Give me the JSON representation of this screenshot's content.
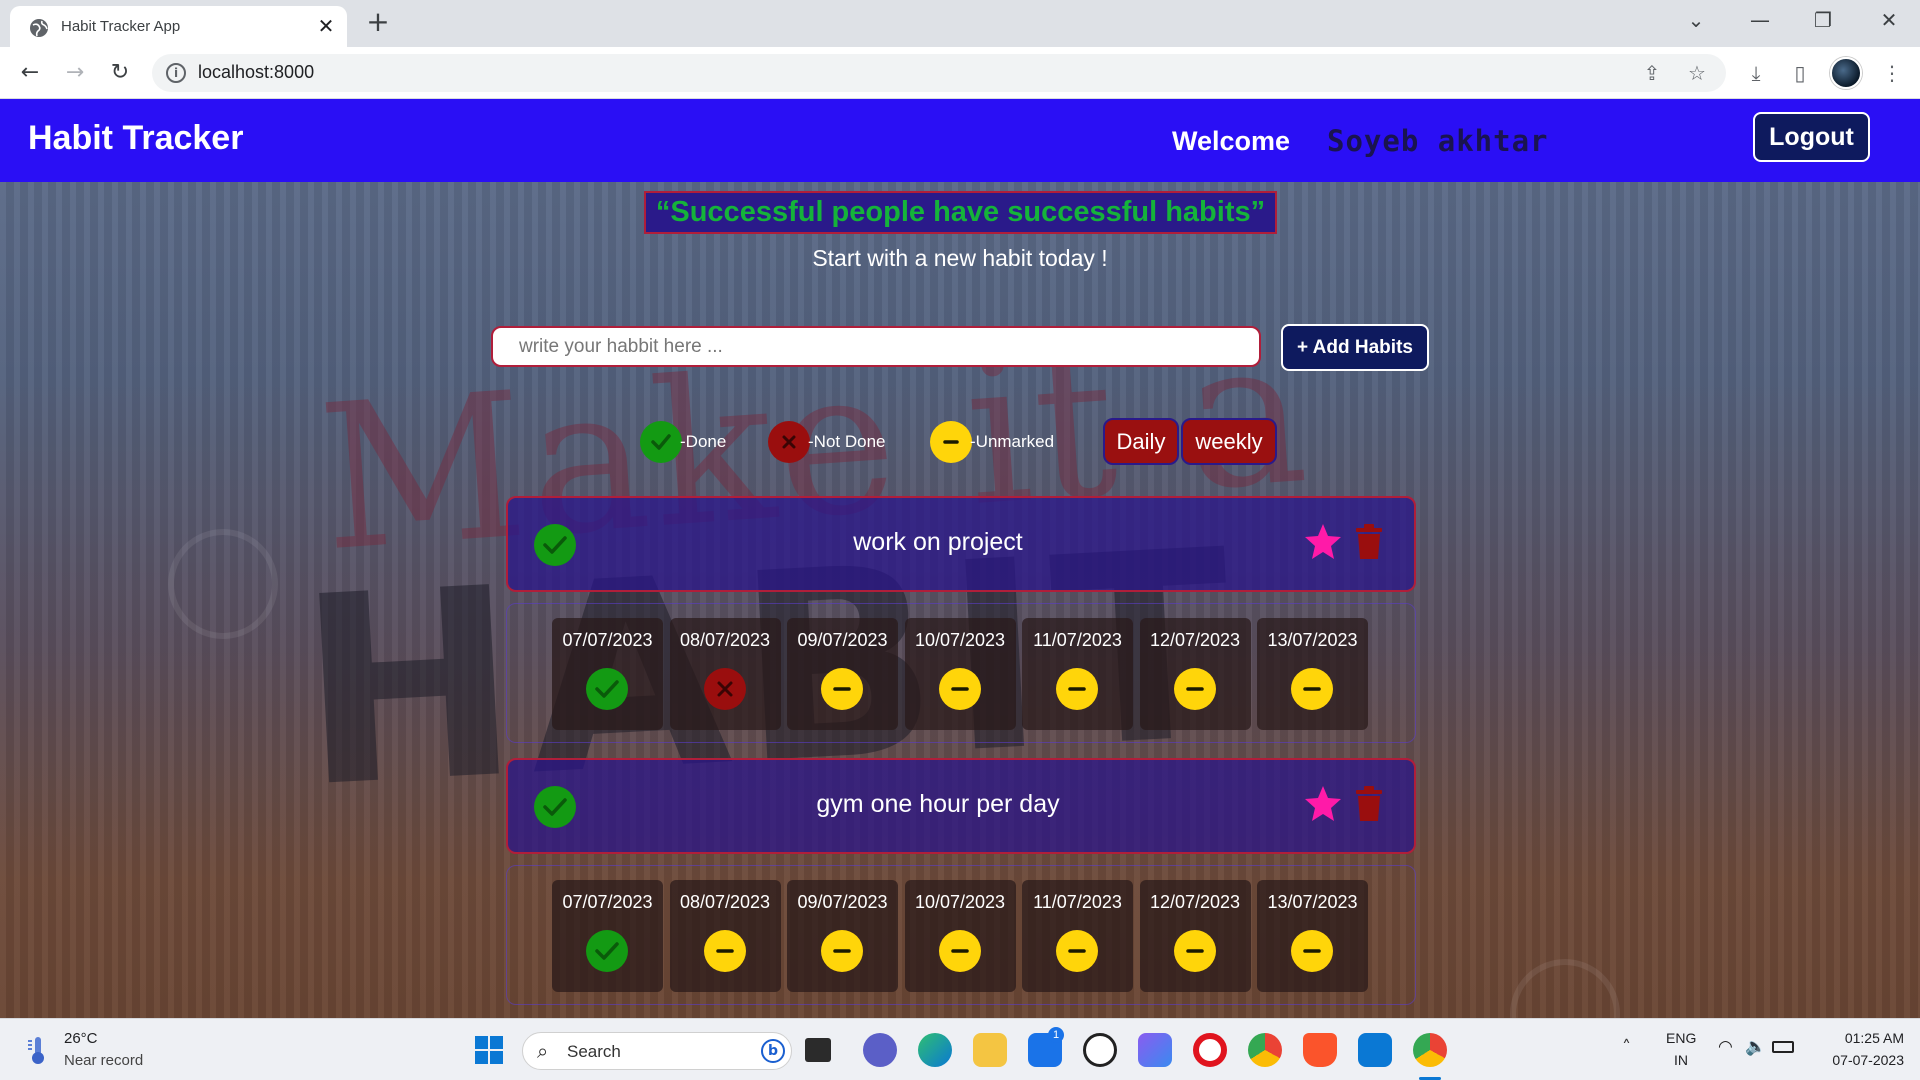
{
  "browser": {
    "tab_title": "Habit Tracker App",
    "url": "localhost:8000"
  },
  "app": {
    "brand": "Habit Tracker",
    "welcome": "Welcome",
    "username": "Soyeb akhtar",
    "logout_label": "Logout",
    "quote": "“Successful people have successful habits”",
    "subtitle": "Start with a new habit today !",
    "input_placeholder": "write your habbit here ...",
    "add_label": "+ Add Habits",
    "legend": {
      "done": "-Done",
      "not_done": "-Not Done",
      "unmarked": "-Unmarked"
    },
    "view_daily": "Daily",
    "view_weekly": "weekly",
    "habits": [
      {
        "name": "work on project",
        "days": [
          {
            "date": "07/07/2023",
            "status": "done"
          },
          {
            "date": "08/07/2023",
            "status": "not_done"
          },
          {
            "date": "09/07/2023",
            "status": "unmarked"
          },
          {
            "date": "10/07/2023",
            "status": "unmarked"
          },
          {
            "date": "11/07/2023",
            "status": "unmarked"
          },
          {
            "date": "12/07/2023",
            "status": "unmarked"
          },
          {
            "date": "13/07/2023",
            "status": "unmarked"
          }
        ]
      },
      {
        "name": "gym one hour per day",
        "days": [
          {
            "date": "07/07/2023",
            "status": "done"
          },
          {
            "date": "08/07/2023",
            "status": "unmarked"
          },
          {
            "date": "09/07/2023",
            "status": "unmarked"
          },
          {
            "date": "10/07/2023",
            "status": "unmarked"
          },
          {
            "date": "11/07/2023",
            "status": "unmarked"
          },
          {
            "date": "12/07/2023",
            "status": "unmarked"
          },
          {
            "date": "13/07/2023",
            "status": "unmarked"
          }
        ]
      }
    ],
    "colors": {
      "navbar": "#2a0ff5",
      "done": "#139a13",
      "not_done": "#9a0e0e",
      "unmarked": "#ffd50a",
      "star": "#ff1aa8",
      "quote_text": "#15b33a"
    }
  },
  "taskbar": {
    "temperature": "26°C",
    "weather_desc": "Near record",
    "search_label": "Search",
    "mail_badge": "1",
    "lang": "ENG",
    "region": "IN",
    "time": "01:25 AM",
    "date": "07-07-2023"
  }
}
